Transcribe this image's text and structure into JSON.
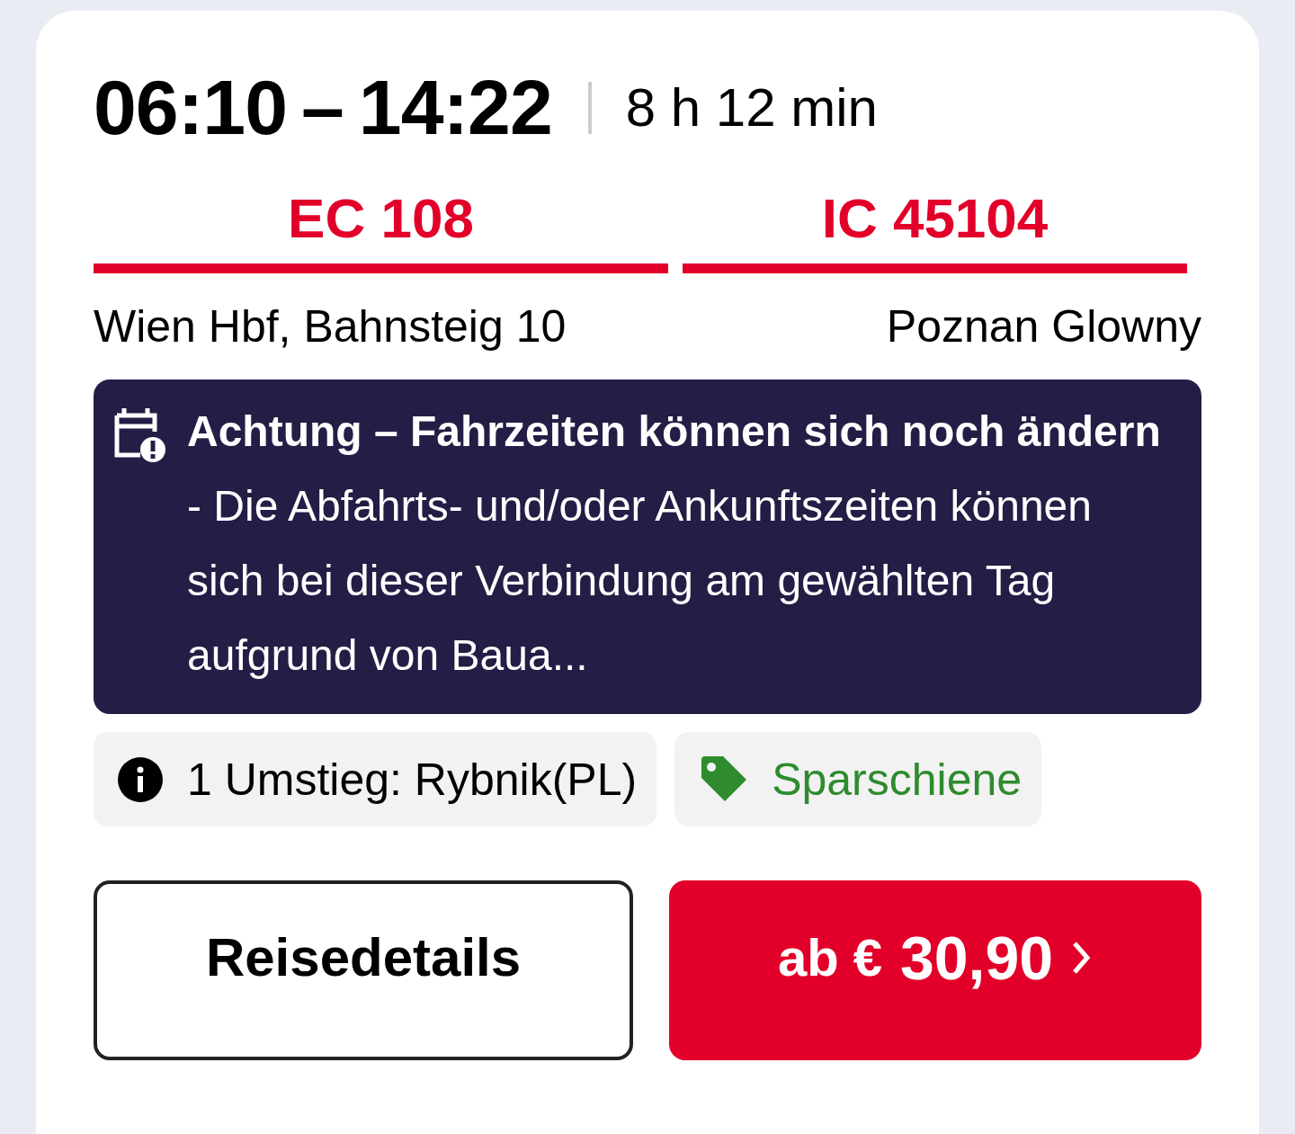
{
  "times": {
    "departure": "06:10",
    "separator": "–",
    "arrival": "14:22",
    "duration": "8 h 12 min"
  },
  "segments": [
    {
      "train": "EC 108"
    },
    {
      "train": "IC 45104"
    }
  ],
  "stations": {
    "from": "Wien Hbf, Bahnsteig 10",
    "to": "Poznan Glowny"
  },
  "notice": {
    "text": "**Achtung – Fahrzeiten können sich noch ändern** - Die Abfahrts- und/oder Ankunftszeiten können sich bei dieser Verbindung am gewählten Tag aufgrund von Baua..."
  },
  "chips": [
    {
      "kind": "info",
      "label": "1 Umstieg: Rybnik(PL)"
    },
    {
      "kind": "offer",
      "label": "Sparschiene"
    }
  ],
  "buttons": {
    "details": "Reisedetails",
    "price_prefix": "ab €",
    "price": "30,90"
  }
}
